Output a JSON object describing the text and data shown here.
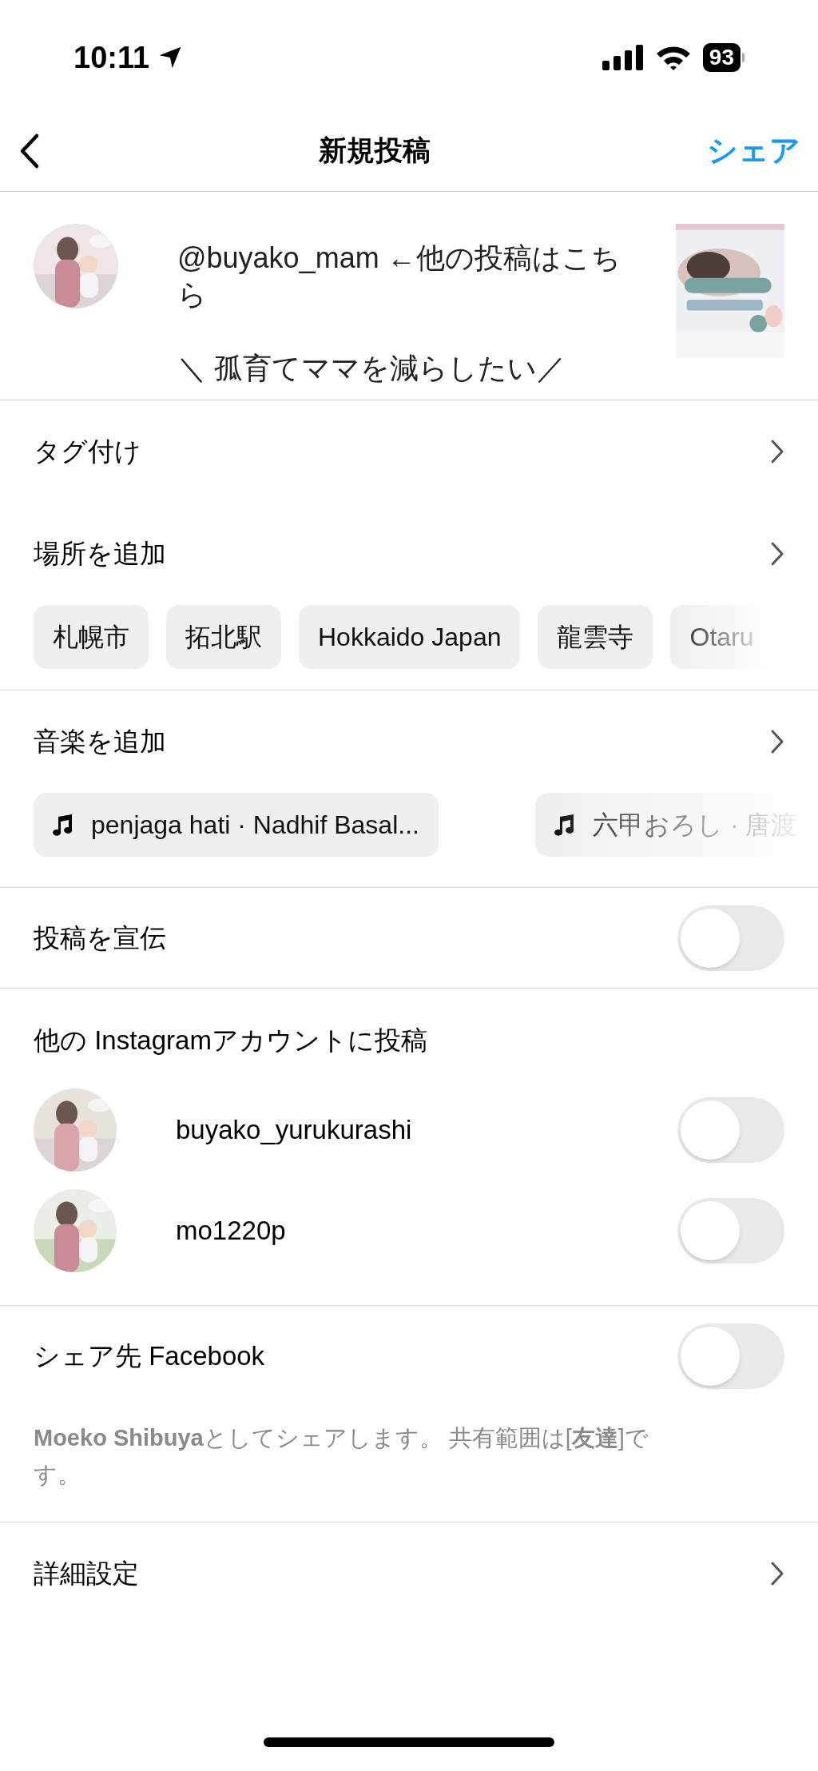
{
  "status_bar": {
    "time": "10:11",
    "battery": "93"
  },
  "nav": {
    "title": "新規投稿",
    "action": "シェア"
  },
  "caption": {
    "lines": [
      "@buyako_mam ←他の投稿はこちら",
      "＼ 孤育てママを減らしたい／"
    ]
  },
  "tag_row": {
    "label": "タグ付け"
  },
  "location_row": {
    "label": "場所を追加"
  },
  "location_chips": [
    {
      "label": "札幌市",
      "faded": false
    },
    {
      "label": "拓北駅",
      "faded": false
    },
    {
      "label": "Hokkaido Japan",
      "faded": false
    },
    {
      "label": "龍雲寺",
      "faded": false
    },
    {
      "label": "Otaru",
      "faded": true
    }
  ],
  "music_row": {
    "label": "音楽を追加"
  },
  "music_chips": [
    {
      "label": "penjaga hati · Nadhif Basal...",
      "faded": false
    },
    {
      "label": "六甲おろし · 唐渡",
      "faded": true
    }
  ],
  "promote": {
    "label": "投稿を宣伝",
    "on": false
  },
  "other_accounts": {
    "title": "他の Instagramアカウントに投稿",
    "accounts": [
      {
        "name": "buyako_yurukurashi",
        "on": false
      },
      {
        "name": "mo1220p",
        "on": false
      }
    ]
  },
  "facebook": {
    "label": "シェア先 Facebook",
    "on": false,
    "note": "**Moeko Shibuya**としてシェアします。 共有範囲は[**友達**]です。"
  },
  "advanced_row": {
    "label": "詳細設定"
  }
}
